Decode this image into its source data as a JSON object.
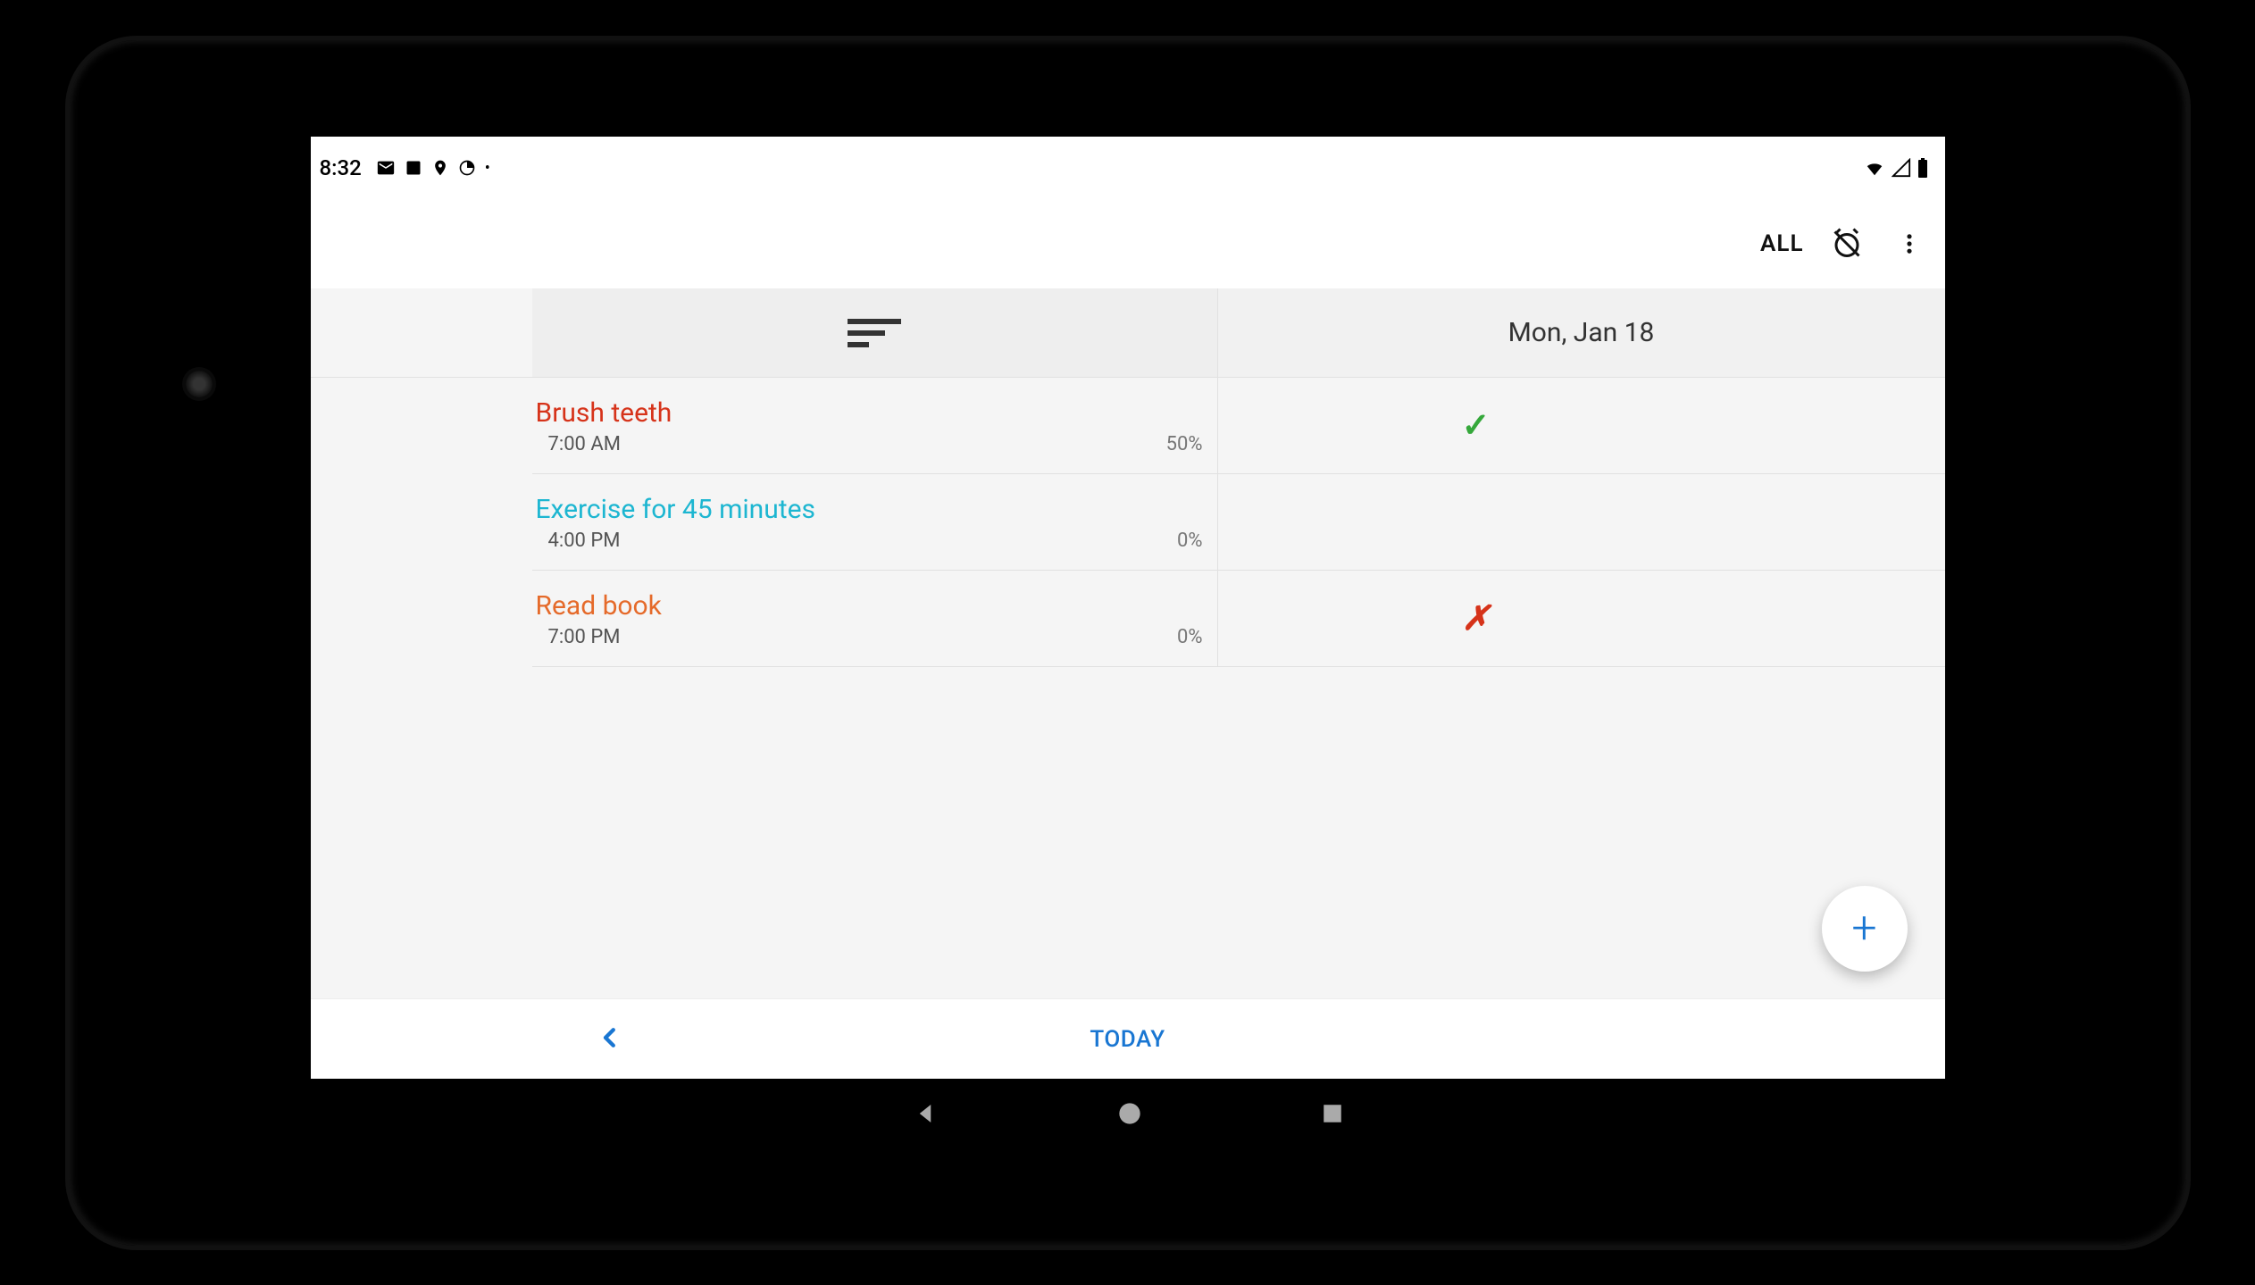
{
  "statusbar": {
    "time": "8:32"
  },
  "appbar": {
    "filter_label": "ALL"
  },
  "header": {
    "date_label": "Mon, Jan 18"
  },
  "habits": [
    {
      "title": "Brush teeth",
      "title_color": "#d6331a",
      "time": "7:00 AM",
      "pct": "50%",
      "status": "check"
    },
    {
      "title": "Exercise for 45 minutes",
      "title_color": "#1db6d1",
      "time": "4:00 PM",
      "pct": "0%",
      "status": "none"
    },
    {
      "title": "Read book",
      "title_color": "#e56a2a",
      "time": "7:00 PM",
      "pct": "0%",
      "status": "cross"
    }
  ],
  "bottom": {
    "today_label": "TODAY"
  },
  "fab": {
    "label": "+"
  }
}
